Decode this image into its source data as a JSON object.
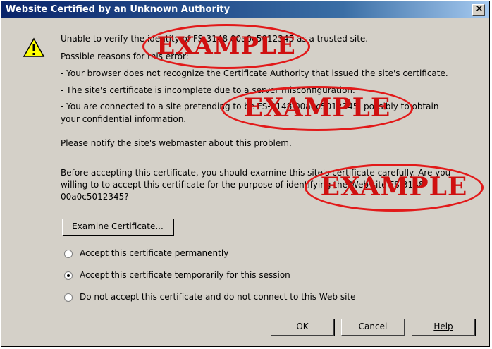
{
  "dialog": {
    "title": "Website Certified by an Unknown Authority",
    "close_glyph": "✕"
  },
  "message": {
    "line1": "Unable to verify the identity of FS-3148 00a0c5012345 as a trusted site.",
    "reasons_heading": "Possible reasons for this error:",
    "reason1": "- Your browser does not recognize the Certificate Authority that issued the site's certificate.",
    "reason2": "- The site's certificate is incomplete due to a server misconfiguration.",
    "reason3a": "- You are connected to a site pretending to be FS-3148 00a0c5012345, possibly to obtain",
    "reason3b": "your confidential information.",
    "notify": "Please notify the site's webmaster about this problem.",
    "before_a": "Before accepting this certificate, you should examine this site's certificate carefully. Are you",
    "before_b": "willing to to accept this certificate for the purpose of identifying the Web site FS-3148",
    "before_c": "00a0c5012345?"
  },
  "buttons": {
    "examine": "Examine Certificate...",
    "ok": "OK",
    "cancel": "Cancel",
    "help": "Help"
  },
  "options": [
    {
      "label": "Accept this certificate permanently",
      "selected": false
    },
    {
      "label": "Accept this certificate temporarily for this session",
      "selected": true
    },
    {
      "label": "Do not accept this certificate and do not connect to this Web site",
      "selected": false
    }
  ],
  "watermark": {
    "text1": "EXAMPLE",
    "text2": "EXAMPLE",
    "text3": "EXAMPLE",
    "color": "#d01010"
  },
  "icons": {
    "warning": "warning-triangle-icon"
  }
}
